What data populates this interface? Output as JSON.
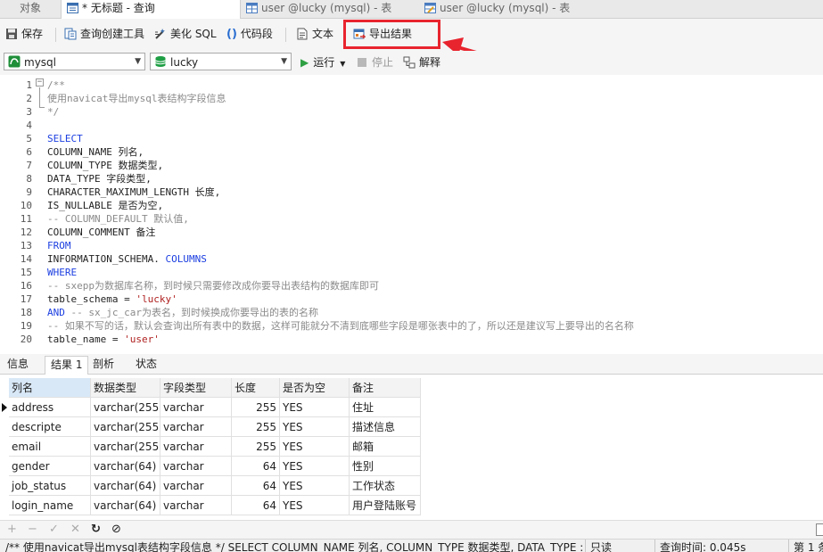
{
  "tabs": [
    {
      "label": "对象"
    },
    {
      "label": "* 无标题 - 查询"
    },
    {
      "label": "user @lucky (mysql) - 表"
    },
    {
      "label": "user @lucky (mysql) - 表"
    }
  ],
  "toolbar": {
    "save": "保存",
    "query_builder": "查询创建工具",
    "beautify": "美化 SQL",
    "snippet": "代码段",
    "text": "文本",
    "export": "导出结果"
  },
  "selectors": {
    "connection": "mysql",
    "database": "lucky",
    "run": "运行",
    "stop": "停止",
    "explain": "解释"
  },
  "editor": {
    "lines": [
      {
        "n": "1",
        "parts": [
          {
            "t": "/**",
            "c": "cm"
          }
        ]
      },
      {
        "n": "2",
        "parts": [
          {
            "t": "使用navicat导出mysql表结构字段信息",
            "c": "cm"
          }
        ]
      },
      {
        "n": "3",
        "parts": [
          {
            "t": "*/",
            "c": "cm"
          }
        ]
      },
      {
        "n": "4",
        "parts": []
      },
      {
        "n": "5",
        "parts": [
          {
            "t": "SELECT",
            "c": "kw"
          }
        ]
      },
      {
        "n": "6",
        "parts": [
          {
            "t": "COLUMN_NAME 列名,",
            "c": "tx"
          }
        ]
      },
      {
        "n": "7",
        "parts": [
          {
            "t": "COLUMN_TYPE 数据类型,",
            "c": "tx"
          }
        ]
      },
      {
        "n": "8",
        "parts": [
          {
            "t": "DATA_TYPE 字段类型,",
            "c": "tx"
          }
        ]
      },
      {
        "n": "9",
        "parts": [
          {
            "t": "CHARACTER_MAXIMUM_LENGTH 长度,",
            "c": "tx"
          }
        ]
      },
      {
        "n": "10",
        "parts": [
          {
            "t": "IS_NULLABLE 是否为空,",
            "c": "tx"
          }
        ]
      },
      {
        "n": "11",
        "parts": [
          {
            "t": "-- COLUMN_DEFAULT 默认值,",
            "c": "cm"
          }
        ]
      },
      {
        "n": "12",
        "parts": [
          {
            "t": "COLUMN_COMMENT 备注",
            "c": "tx"
          }
        ]
      },
      {
        "n": "13",
        "parts": [
          {
            "t": "FROM",
            "c": "kw"
          }
        ]
      },
      {
        "n": "14",
        "parts": [
          {
            "t": "INFORMATION_SCHEMA. ",
            "c": "tx"
          },
          {
            "t": "COLUMNS",
            "c": "kw"
          }
        ]
      },
      {
        "n": "15",
        "parts": [
          {
            "t": "WHERE",
            "c": "kw"
          }
        ]
      },
      {
        "n": "16",
        "parts": [
          {
            "t": "-- sxepp为数据库名称，到时候只需要修改成你要导出表结构的数据库即可",
            "c": "cm"
          }
        ]
      },
      {
        "n": "17",
        "parts": [
          {
            "t": "table_schema = ",
            "c": "tx"
          },
          {
            "t": "'lucky'",
            "c": "st"
          }
        ]
      },
      {
        "n": "18",
        "parts": [
          {
            "t": "AND",
            "c": "kw"
          },
          {
            "t": " -- sx_jc_car为表名，到时候换成你要导出的表的名称",
            "c": "cm"
          }
        ]
      },
      {
        "n": "19",
        "parts": [
          {
            "t": "-- 如果不写的话，默认会查询出所有表中的数据，这样可能就分不清到底哪些字段是哪张表中的了，所以还是建议写上要导出的名名称",
            "c": "cm"
          }
        ]
      },
      {
        "n": "20",
        "parts": [
          {
            "t": "table_name = ",
            "c": "tx"
          },
          {
            "t": "'user'",
            "c": "st"
          }
        ]
      }
    ]
  },
  "result_tabs": [
    {
      "label": "信息"
    },
    {
      "label": "结果 1"
    },
    {
      "label": "剖析"
    },
    {
      "label": "状态"
    }
  ],
  "grid": {
    "headers": [
      "列名",
      "数据类型",
      "字段类型",
      "长度",
      "是否为空",
      "备注"
    ],
    "rows": [
      [
        "address",
        "varchar(255)",
        "varchar",
        "255",
        "YES",
        "住址"
      ],
      [
        "descripte",
        "varchar(255)",
        "varchar",
        "255",
        "YES",
        "描述信息"
      ],
      [
        "email",
        "varchar(255)",
        "varchar",
        "255",
        "YES",
        "邮箱"
      ],
      [
        "gender",
        "varchar(64)",
        "varchar",
        "64",
        "YES",
        "性别"
      ],
      [
        "job_status",
        "varchar(64)",
        "varchar",
        "64",
        "YES",
        "工作状态"
      ],
      [
        "login_name",
        "varchar(64)",
        "varchar",
        "64",
        "YES",
        "用户登陆账号"
      ]
    ]
  },
  "statusbar": {
    "sql": "/** 使用navicat导出mysql表结构字段信息 */   SELECT COLUMN_NAME 列名, COLUMN_TYPE 数据类型, DATA_TYPE :",
    "mode": "只读",
    "time": "查询时间: 0.045s",
    "records": "第 1 条"
  },
  "colors": {
    "annotation": "#e8242e",
    "keyword": "#1b3ee0",
    "comment": "#8a8a8a",
    "string": "#b02020"
  }
}
